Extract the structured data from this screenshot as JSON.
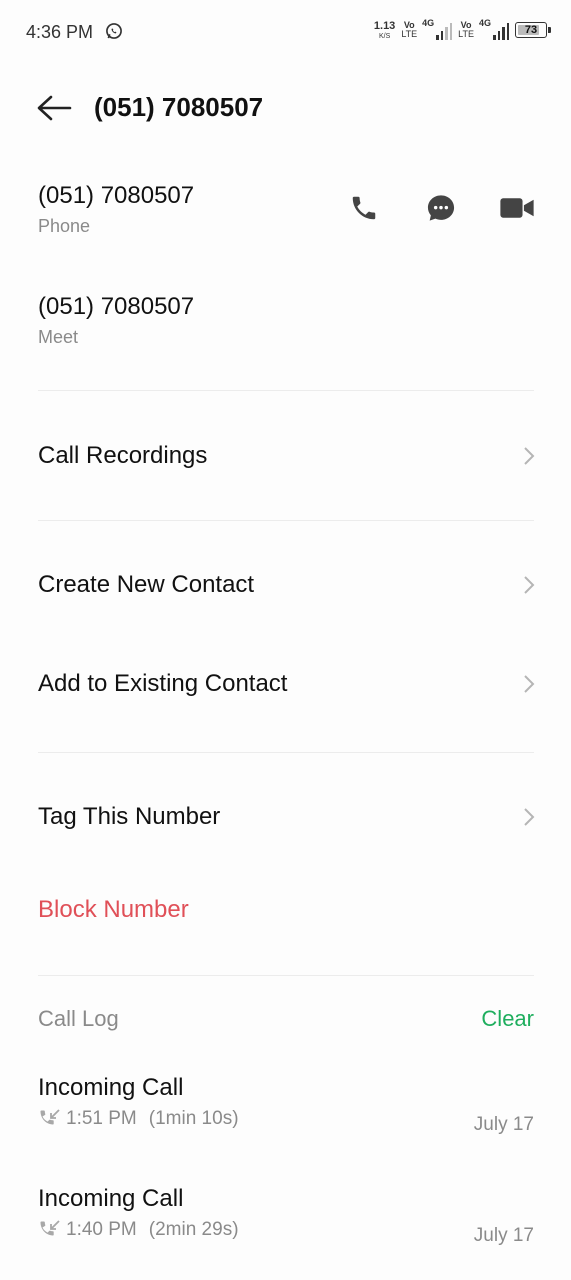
{
  "status_bar": {
    "time": "4:36 PM",
    "net_speed_value": "1.13",
    "net_speed_unit": "K/S",
    "volte1_top": "Vo",
    "volte1_bottom": "LTE",
    "sig1_label": "4G",
    "volte2_top": "Vo",
    "volte2_bottom": "LTE",
    "sig2_label": "4G",
    "battery_level": "73",
    "icons": [
      "whatsapp-icon",
      "signal-icon",
      "battery-icon"
    ]
  },
  "header": {
    "title": "(051) 7080507",
    "back_icon": "arrow-left-icon"
  },
  "numbers": [
    {
      "number": "(051) 7080507",
      "type": "Phone"
    },
    {
      "number": "(051) 7080507",
      "type": "Meet"
    }
  ],
  "actions": [
    "phone-icon",
    "message-icon",
    "video-call-icon"
  ],
  "menu": {
    "call_recordings": "Call Recordings",
    "create_new_contact": "Create New Contact",
    "add_to_existing": "Add to Existing Contact",
    "tag_number": "Tag This Number",
    "block_number": "Block Number"
  },
  "call_log": {
    "label": "Call Log",
    "clear": "Clear",
    "entries": [
      {
        "kind": "Incoming Call",
        "time": "1:51 PM",
        "duration": "(1min 10s)",
        "date": "July 17"
      },
      {
        "kind": "Incoming Call",
        "time": "1:40 PM",
        "duration": "(2min 29s)",
        "date": "July 17"
      }
    ]
  },
  "colors": {
    "block": "#e05058",
    "clear": "#1fae5e",
    "secondary_text": "#8a8a8a"
  }
}
